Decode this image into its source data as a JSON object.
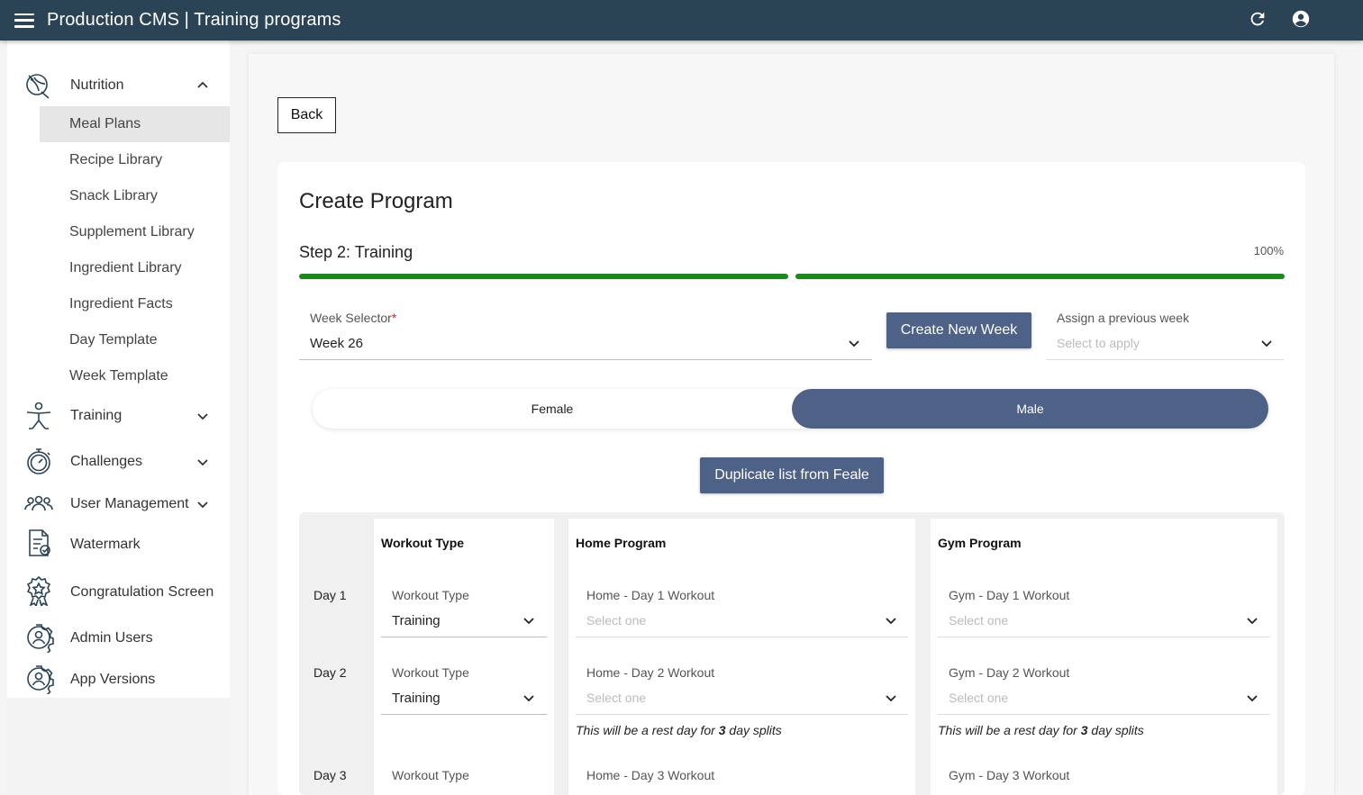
{
  "header": {
    "title": "Production CMS | Training programs",
    "icons": [
      "menu-icon",
      "refresh-icon",
      "account-icon"
    ]
  },
  "sidebar": {
    "nutrition": {
      "label": "Nutrition",
      "icon": "nutrition-icon",
      "expanded": true
    },
    "nutrition_items": [
      {
        "label": "Meal Plans",
        "active": true
      },
      {
        "label": "Recipe Library"
      },
      {
        "label": "Snack Library"
      },
      {
        "label": "Supplement Library"
      },
      {
        "label": "Ingredient Library"
      },
      {
        "label": "Ingredient Facts"
      },
      {
        "label": "Day Template"
      },
      {
        "label": "Week Template"
      }
    ],
    "sections": [
      {
        "label": "Training",
        "icon": "training-icon",
        "has_chevron": true
      },
      {
        "label": "Challenges",
        "icon": "stopwatch-icon",
        "has_chevron": true
      },
      {
        "label": "User Management",
        "icon": "users-icon",
        "has_chevron": true
      },
      {
        "label": "Watermark",
        "icon": "document-check-icon"
      },
      {
        "label": "Congratulation Screen",
        "icon": "badge-icon"
      },
      {
        "label": "Admin Users",
        "icon": "gear-user-icon"
      },
      {
        "label": "App Versions",
        "icon": "gear-user-icon"
      }
    ]
  },
  "page": {
    "back_label": "Back",
    "card_title": "Create Program",
    "step_title": "Step 2: Training",
    "progress": {
      "percent_label": "100%",
      "value": 1.0
    },
    "week_selector": {
      "label": "Week Selector",
      "required_mark": "*",
      "value": "Week 26"
    },
    "create_week_label": "Create New Week",
    "assign_previous": {
      "label": "Assign a previous week",
      "placeholder": "Select to apply"
    },
    "gender_toggle": {
      "options": [
        "Female",
        "Male"
      ],
      "selected": "Male"
    },
    "duplicate_label": "Duplicate list from Feale",
    "columns": {
      "workout_type": "Workout Type",
      "home_program": "Home Program",
      "gym_program": "Gym Program"
    },
    "days": [
      {
        "day": "Day 1",
        "type_label": "Workout Type",
        "type_value": "Training",
        "home_label": "Home - Day 1 Workout",
        "home_placeholder": "Select one",
        "gym_label": "Gym - Day 1 Workout",
        "gym_placeholder": "Select one"
      },
      {
        "day": "Day 2",
        "type_label": "Workout Type",
        "type_value": "Training",
        "home_label": "Home - Day 2 Workout",
        "home_placeholder": "Select one",
        "gym_label": "Gym - Day 2 Workout",
        "gym_placeholder": "Select one",
        "note_prefix": "This will be a rest day for ",
        "note_number": "3",
        "note_suffix": " day splits"
      },
      {
        "day": "Day 3",
        "type_label": "Workout Type",
        "home_label": "Home - Day 3 Workout",
        "gym_label": "Gym - Day 3 Workout"
      }
    ]
  }
}
